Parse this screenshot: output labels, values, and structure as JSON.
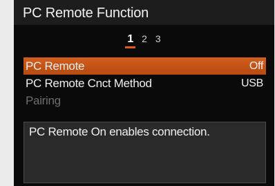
{
  "header": {
    "title": "PC Remote Function"
  },
  "pagination": {
    "pages": [
      "1",
      "2",
      "3"
    ],
    "current": "1"
  },
  "menu": {
    "items": [
      {
        "label": "PC Remote",
        "value": "Off"
      },
      {
        "label": "PC Remote Cnct Method",
        "value": "USB"
      },
      {
        "label": "Pairing",
        "value": ""
      }
    ]
  },
  "help": {
    "text": "PC Remote On enables connection."
  },
  "colors": {
    "accent": "#d25e1c",
    "background": "#0a0a0a",
    "title_bar": "#1d1d1d",
    "disabled_text": "#6e6e6e"
  }
}
